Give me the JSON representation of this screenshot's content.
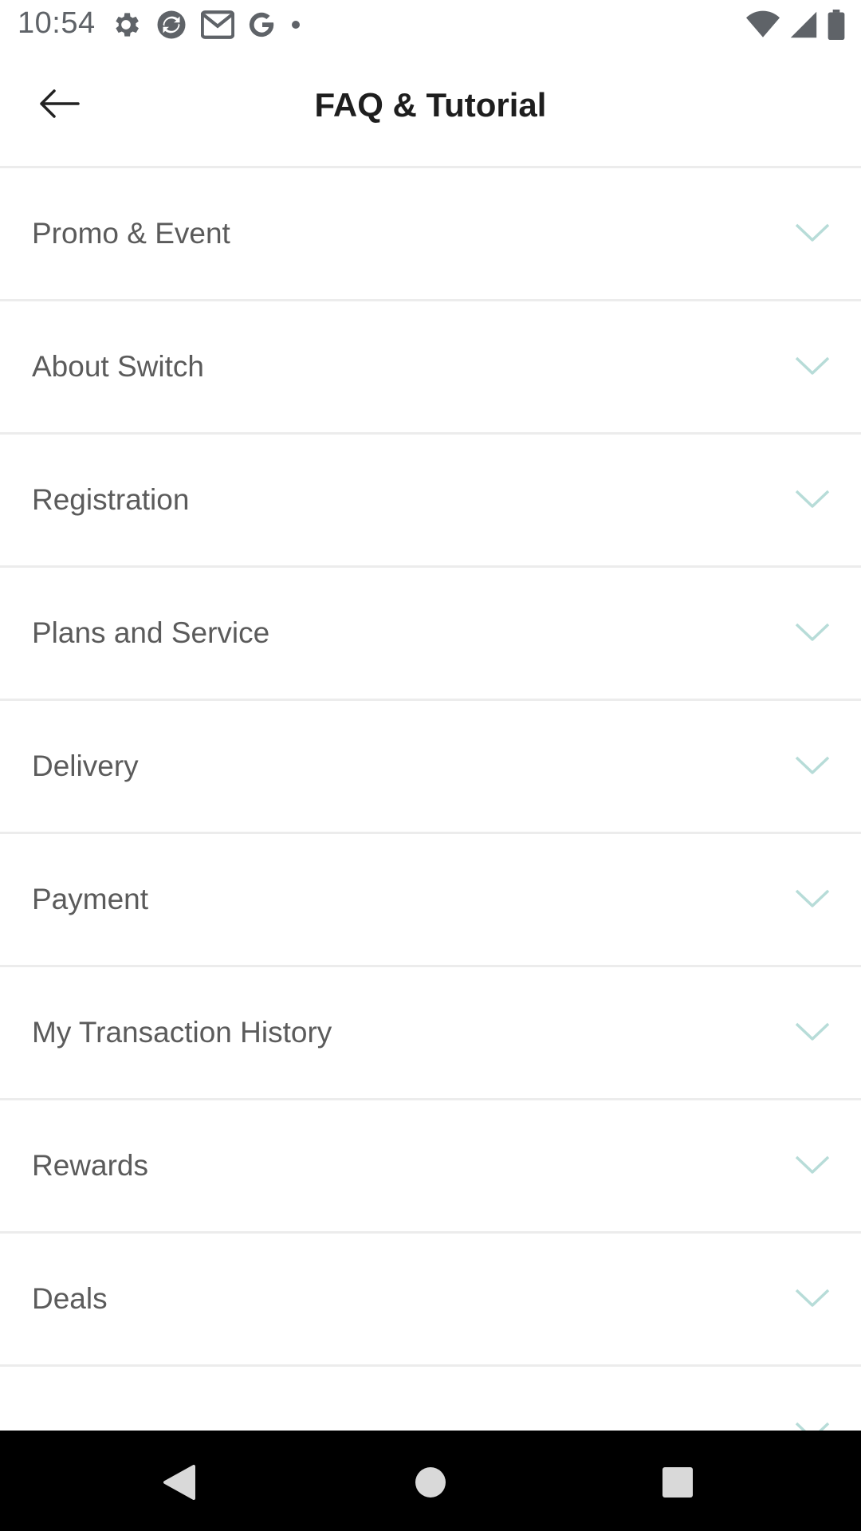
{
  "status_bar": {
    "time": "10:54",
    "left_icons": [
      "settings-gear-icon",
      "sync-app-icon",
      "gmail-icon",
      "google-icon",
      "notification-dot-icon"
    ],
    "right_icons": [
      "wifi-icon",
      "cellular-signal-icon",
      "battery-icon"
    ]
  },
  "header": {
    "title": "FAQ & Tutorial",
    "back_icon": "back-arrow-icon"
  },
  "faq": {
    "items": [
      {
        "label": "Promo & Event"
      },
      {
        "label": "About Switch"
      },
      {
        "label": "Registration"
      },
      {
        "label": "Plans and Service"
      },
      {
        "label": "Delivery"
      },
      {
        "label": "Payment"
      },
      {
        "label": "My Transaction History"
      },
      {
        "label": "Rewards"
      },
      {
        "label": "Deals"
      }
    ],
    "expand_icon": "chevron-down-icon"
  },
  "nav_bar": {
    "buttons": [
      "back-triangle-icon",
      "home-circle-icon",
      "recents-square-icon"
    ]
  },
  "colors": {
    "divider": "#ececec",
    "label_text": "#5b5b5b",
    "chevron": "#b7dcd8",
    "title_text": "#1e1e1e",
    "nav_bar": "#000000"
  }
}
